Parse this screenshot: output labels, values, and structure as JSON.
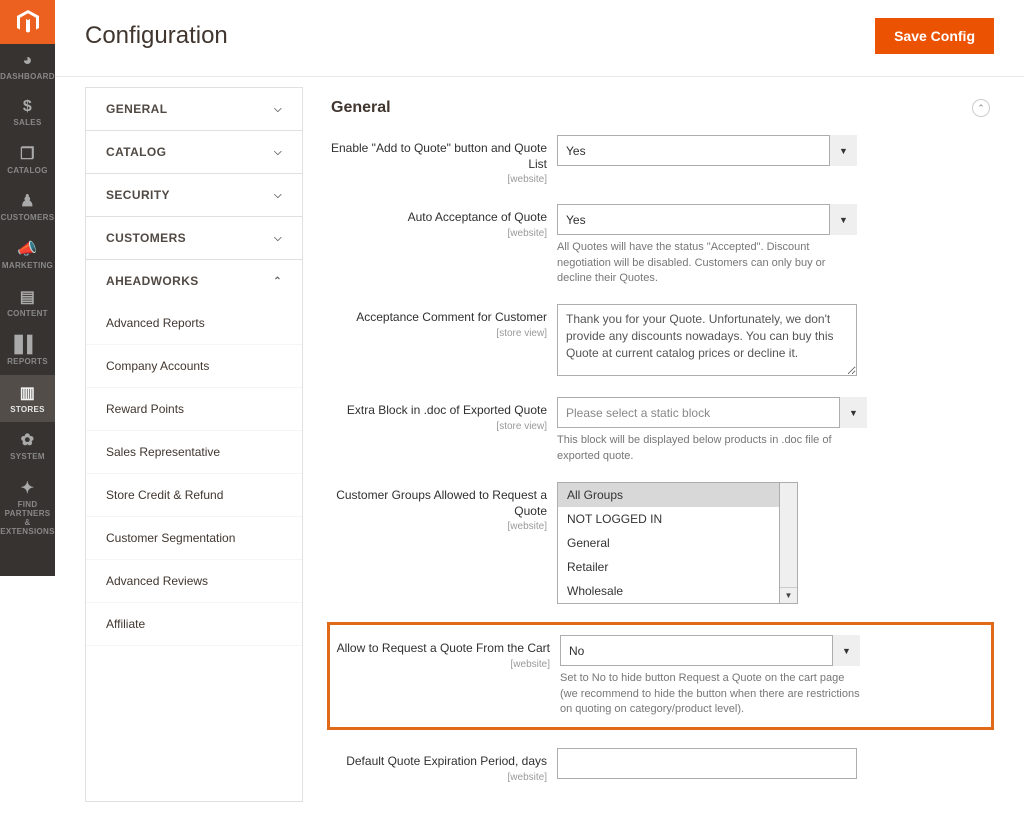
{
  "page": {
    "title": "Configuration",
    "save": "Save Config"
  },
  "sidenav": {
    "dashboard": "DASHBOARD",
    "sales": "SALES",
    "catalog": "CATALOG",
    "customers": "CUSTOMERS",
    "marketing": "MARKETING",
    "content": "CONTENT",
    "reports": "REPORTS",
    "stores": "STORES",
    "system": "SYSTEM",
    "partners": "FIND PARTNERS\n& EXTENSIONS"
  },
  "tabs": {
    "general": "GENERAL",
    "catalog": "CATALOG",
    "security": "SECURITY",
    "customers": "CUSTOMERS",
    "aheadworks": "AHEADWORKS",
    "aw_items": {
      "advanced_reports": "Advanced Reports",
      "company_accounts": "Company Accounts",
      "reward_points": "Reward Points",
      "sales_rep": "Sales Representative",
      "store_credit": "Store Credit & Refund",
      "cust_seg": "Customer Segmentation",
      "adv_reviews": "Advanced Reviews",
      "affiliate": "Affiliate"
    }
  },
  "section": {
    "title": "General"
  },
  "scopes": {
    "website": "[website]",
    "store": "[store view]"
  },
  "fields": {
    "enable": {
      "label": "Enable \"Add to Quote\" button and Quote List",
      "value": "Yes"
    },
    "auto_accept": {
      "label": "Auto Acceptance of Quote",
      "value": "Yes",
      "note": "All Quotes will have the status \"Accepted\". Discount negotiation will be disabled. Customers can only buy or decline their Quotes."
    },
    "accept_comment": {
      "label": "Acceptance Comment for Customer",
      "value": "Thank you for your Quote. Unfortunately, we don't provide any discounts nowadays. You can buy this Quote at current catalog prices or decline it."
    },
    "extra_block": {
      "label": "Extra Block in .doc of Exported Quote",
      "placeholder": "Please select a static block",
      "note": "This block will be displayed below products in .doc file of exported quote."
    },
    "groups": {
      "label": "Customer Groups Allowed to Request a Quote",
      "options": [
        "All Groups",
        "NOT LOGGED IN",
        "General",
        "Retailer",
        "Wholesale"
      ],
      "selected": "All Groups"
    },
    "allow_cart": {
      "label": "Allow to Request a Quote From the Cart",
      "value": "No",
      "note": "Set to No to hide button Request a Quote on the cart page (we recommend to hide the button when there are restrictions on quoting on category/product level)."
    },
    "expiration": {
      "label": "Default Quote Expiration Period, days"
    }
  }
}
